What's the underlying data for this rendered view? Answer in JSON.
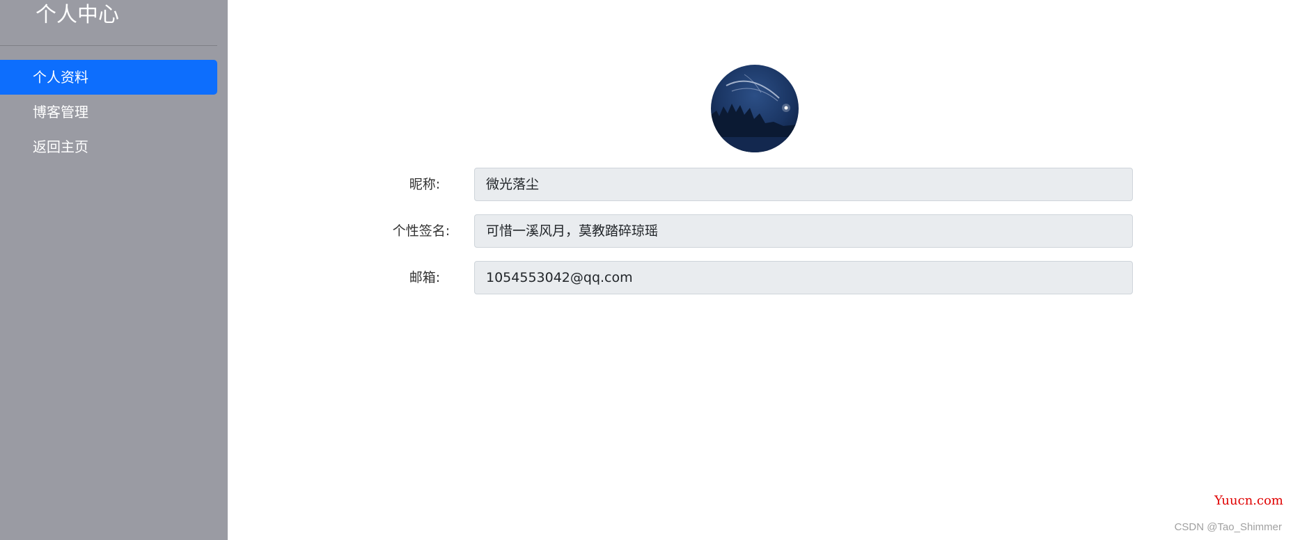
{
  "sidebar": {
    "title": "个人中心",
    "items": [
      {
        "label": "个人资料",
        "active": true
      },
      {
        "label": "博客管理",
        "active": false
      },
      {
        "label": "返回主页",
        "active": false
      }
    ]
  },
  "profile": {
    "avatar_icon": "avatar-night-sky-image",
    "fields": [
      {
        "label": "昵称:",
        "value": "微光落尘"
      },
      {
        "label": "个性签名:",
        "value": "可惜一溪风月，莫教踏碎琼瑶"
      },
      {
        "label": "邮箱:",
        "value": "1054553042@qq.com"
      }
    ]
  },
  "watermarks": {
    "site": "Yuucn.com",
    "csdn": "CSDN @Tao_Shimmer"
  },
  "colors": {
    "sidebar_bg": "#9a9ba3",
    "active_item": "#0d6efd",
    "input_bg": "#e9ecef"
  }
}
